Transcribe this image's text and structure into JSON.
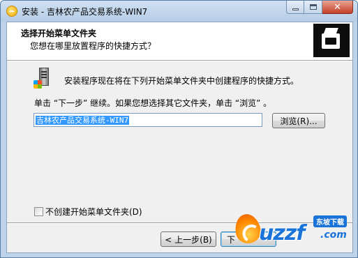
{
  "window": {
    "title": "安装 - 吉林农产品交易系统-WIN7",
    "controls": {
      "minimize": "minimize",
      "maximize": "maximize",
      "close": "✕"
    }
  },
  "header": {
    "title": "选择开始菜单文件夹",
    "subtitle": "您想在哪里放置程序的快捷方式？"
  },
  "body": {
    "description": "安装程序现在将在下列开始菜单文件夹中创建程序的快捷方式。",
    "instruction": "单击 “下一步” 继续。如果您想选择其它文件夹，单击 “浏览” 。",
    "folder_value": "吉林农产品交易系统-WIN7",
    "browse_label": "浏览(R)...",
    "no_start_menu_label": "不创建开始菜单文件夹(D)",
    "no_start_menu_checked": false
  },
  "footer": {
    "back_label": "< 上一步(B)",
    "next_label": "下"
  },
  "watermark": {
    "brand": "uzzf",
    "badge": "东坡下载",
    "suffix": ".com"
  }
}
